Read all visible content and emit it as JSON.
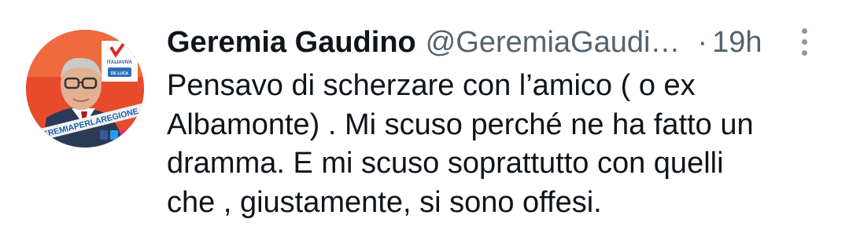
{
  "tweet": {
    "author": {
      "display_name": "Geremia Gaudino",
      "handle": "@GeremiaGaudi…",
      "avatar_icon": "profile-photo",
      "avatar_text": {
        "party": "ITALIAVIVA",
        "party_sub": "DE LUCA",
        "banner": "GEREMIAPERLAREGIONE",
        "social_icons": [
          "facebook-icon",
          "twitter-icon",
          "instagram-icon"
        ]
      }
    },
    "separator": "·",
    "timestamp": "19h",
    "more_icon": "more-vertical-icon",
    "text_lines": [
      "Pensavo di scherzare con l’amico ( o ex",
      "Albamonte) . Mi scuso perché ne ha fatto un",
      "dramma. E mi scuso soprattutto con quelli",
      "che , giustamente, si sono offesi."
    ],
    "colors": {
      "primary_text": "#0f1419",
      "secondary_text": "#536471",
      "avatar_background": "#e84a2c"
    }
  }
}
